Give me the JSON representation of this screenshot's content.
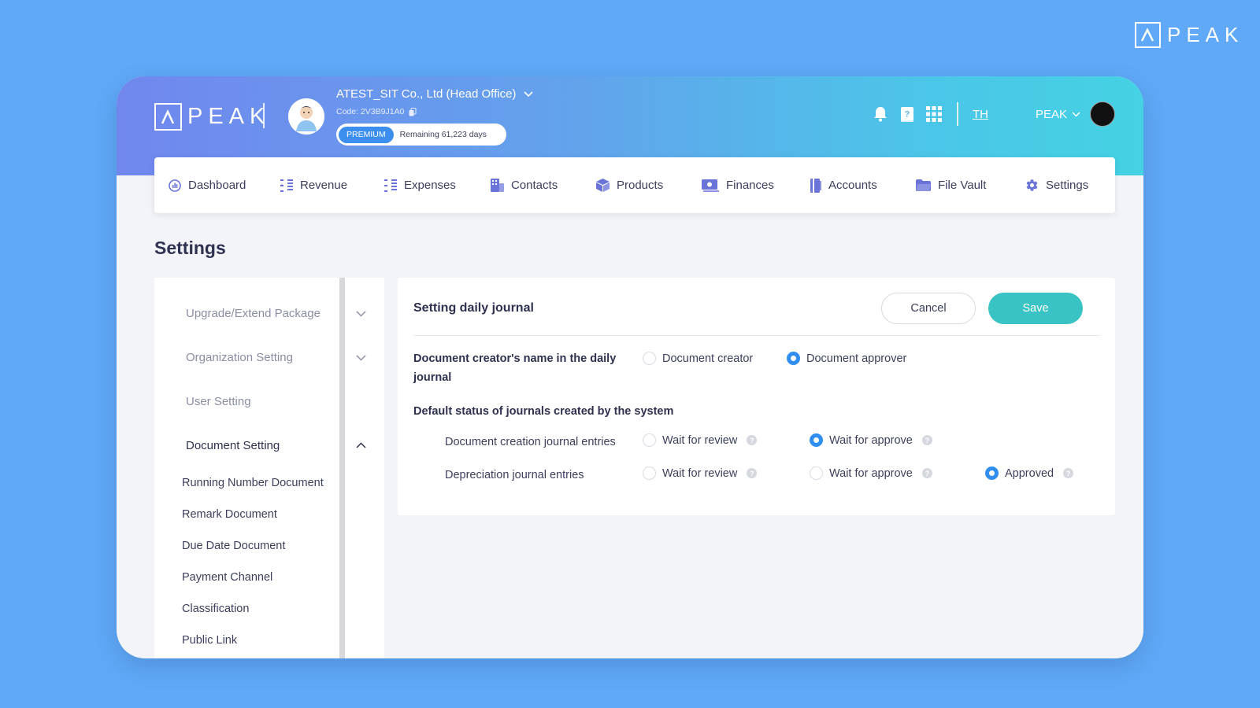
{
  "brand": {
    "name": "PEAK"
  },
  "header": {
    "org_name": "ATEST_SIT Co., Ltd (Head Office)",
    "org_code": "Code: 2V3B9J1A0",
    "package_badge": "PREMIUM",
    "package_remaining": "Remaining 61,223 days",
    "language": "TH",
    "user_name": "PEAK"
  },
  "nav": {
    "items": [
      {
        "label": "Dashboard",
        "icon": "dashboard-icon"
      },
      {
        "label": "Revenue",
        "icon": "revenue-icon"
      },
      {
        "label": "Expenses",
        "icon": "expenses-icon"
      },
      {
        "label": "Contacts",
        "icon": "contacts-icon"
      },
      {
        "label": "Products",
        "icon": "products-icon"
      },
      {
        "label": "Finances",
        "icon": "finances-icon"
      },
      {
        "label": "Accounts",
        "icon": "accounts-icon"
      },
      {
        "label": "File Vault",
        "icon": "folder-icon"
      },
      {
        "label": "Settings",
        "icon": "gear-icon"
      }
    ]
  },
  "page": {
    "title": "Settings"
  },
  "sidebar": {
    "sections": [
      {
        "label": "Upgrade/Extend Package",
        "expanded": false
      },
      {
        "label": "Organization Setting",
        "expanded": false
      },
      {
        "label": "User Setting"
      },
      {
        "label": "Document Setting",
        "expanded": true
      }
    ],
    "sub_items": [
      "Running Number Document",
      "Remark Document",
      "Due Date Document",
      "Payment Channel",
      "Classification",
      "Public Link"
    ]
  },
  "panel": {
    "title": "Setting daily journal",
    "cancel_label": "Cancel",
    "save_label": "Save",
    "creator_name_label": "Document creator's name in the daily journal",
    "creator_options": [
      "Document creator",
      "Document approver"
    ],
    "creator_selected": "Document approver",
    "default_status_label": "Default status of journals created by the system",
    "rows": [
      {
        "label": "Document creation journal entries",
        "options": [
          "Wait for review",
          "Wait for approve"
        ],
        "selected": "Wait for approve"
      },
      {
        "label": "Depreciation journal entries",
        "options": [
          "Wait for review",
          "Wait for approve",
          "Approved"
        ],
        "selected": "Approved"
      }
    ]
  },
  "colors": {
    "background": "#5fa9f8",
    "accent": "#3ac3c4",
    "radio_selected": "#2f8ef0",
    "header_start": "#7187ee",
    "header_end": "#44d2e4"
  }
}
